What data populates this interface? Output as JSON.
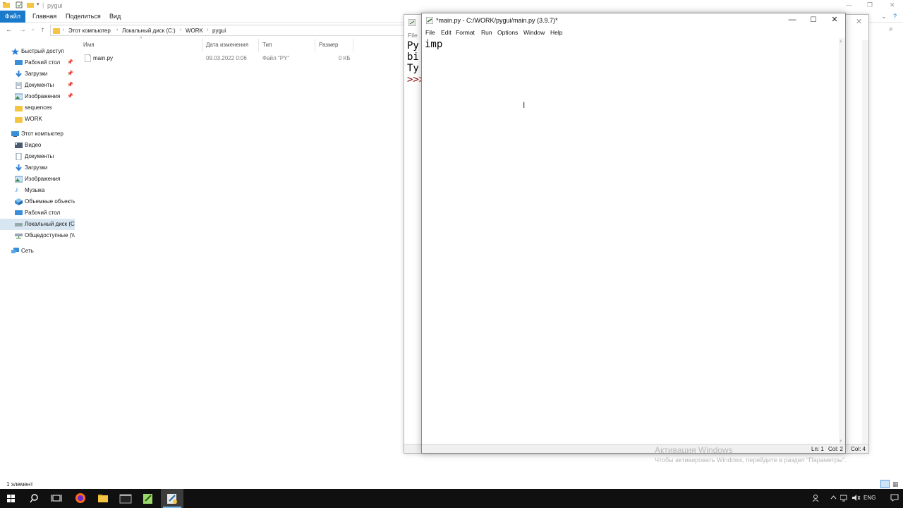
{
  "explorer": {
    "title": "pygui",
    "ribbon": {
      "file": "Файл",
      "home": "Главная",
      "share": "Поделиться",
      "view": "Вид"
    },
    "breadcrumb": [
      "Этот компьютер",
      "Локальный диск (C:)",
      "WORK",
      "pygui"
    ],
    "nav": {
      "quick_access": "Быстрый доступ",
      "quick_items": [
        "Рабочий стол",
        "Загрузки",
        "Документы",
        "Изображения",
        "sequences",
        "WORK"
      ],
      "this_pc": "Этот компьютер",
      "pc_items": [
        "Видео",
        "Документы",
        "Загрузки",
        "Изображения",
        "Музыка",
        "Объемные объекты",
        "Рабочий стол",
        "Локальный диск (C:)",
        "Общедоступные (\\\\"
      ],
      "network": "Сеть"
    },
    "columns": [
      "Имя",
      "Дата изменения",
      "Тип",
      "Размер"
    ],
    "files": [
      {
        "name": "main.py",
        "date": "09.03.2022 0:06",
        "type": "Файл \"PY\"",
        "size": "0 КБ"
      }
    ],
    "status": "1 элемент"
  },
  "shell": {
    "menu_first": "File",
    "lines": [
      "Py",
      "bi",
      "Ty",
      ">>>"
    ]
  },
  "editor": {
    "title": "*main.py - C:/WORK/pygui/main.py (3.9.7)*",
    "menu": [
      "File",
      "Edit",
      "Format",
      "Run",
      "Options",
      "Window",
      "Help"
    ],
    "code": "imp",
    "status": {
      "ln": "Ln: 1",
      "col": "Col: 2",
      "shell_col": "Col: 4"
    }
  },
  "watermark": {
    "title": "Активация Windows",
    "subtitle": "Чтобы активировать Windows, перейдите в раздел \"Параметры\"."
  },
  "taskbar": {
    "lang": "ENG"
  },
  "colors": {
    "accent": "#1979ca",
    "selected_bg": "#d8e6f2",
    "taskbar_bg": "#101010",
    "prompt_red": "#8b0000"
  }
}
